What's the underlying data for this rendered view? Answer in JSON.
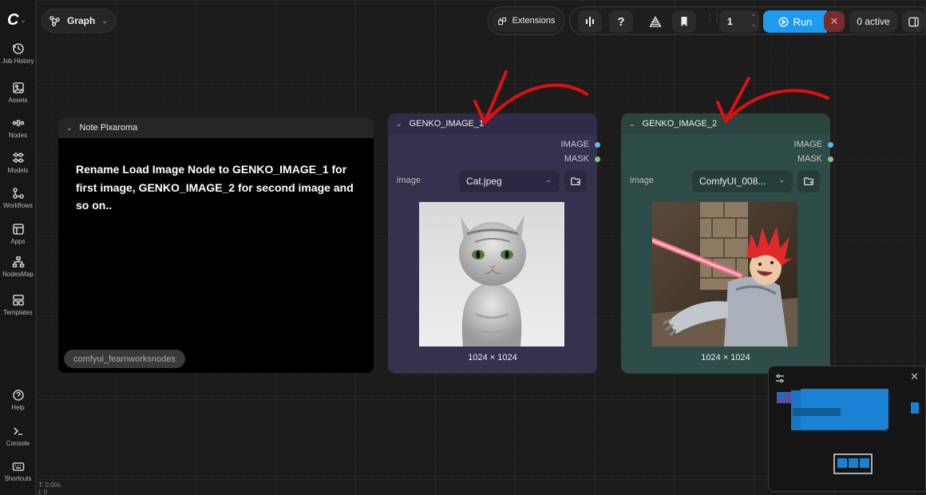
{
  "sidebar": {
    "logo_text": "C",
    "items": [
      {
        "icon": "history-icon",
        "label": "Job History"
      },
      {
        "icon": "image-icon",
        "label": "Assets"
      },
      {
        "icon": "nodes-icon",
        "label": "Nodes"
      },
      {
        "icon": "models-icon",
        "label": "Models"
      },
      {
        "icon": "workflow-icon",
        "label": "Workflows"
      },
      {
        "icon": "apps-icon",
        "label": "Apps"
      },
      {
        "icon": "sitemap-icon",
        "label": "NodesMap"
      },
      {
        "icon": "templates-icon",
        "label": "Templates"
      }
    ],
    "bottom_items": [
      {
        "icon": "help-icon",
        "label": "Help"
      },
      {
        "icon": "terminal-icon",
        "label": "Console"
      },
      {
        "icon": "keyboard-icon",
        "label": "Shortcuts"
      }
    ],
    "status_time": "T: 0.00s",
    "status_line2": "I: 0"
  },
  "topbar": {
    "graph_label": "Graph",
    "extensions_label": "Extensions",
    "queue_count": "1",
    "run_label": "Run",
    "active_label": "0 active",
    "stop_icon": "x",
    "help_label": "?"
  },
  "canvas": {
    "note_node": {
      "title": "Note Pixaroma",
      "text": "Rename Load Image Node to GENKO_IMAGE_1 for first image, GENKO_IMAGE_2 for second image and so on..",
      "tag": "comfyui_fearnworksnodes"
    },
    "image_nodes": [
      {
        "title": "GENKO_IMAGE_1",
        "outputs": [
          "IMAGE",
          "MASK"
        ],
        "widget_label": "image",
        "file": "Cat.jpeg",
        "dimensions": "1024 × 1024",
        "bg_color": "#353250",
        "header_color": "#2f2c48"
      },
      {
        "title": "GENKO_IMAGE_2",
        "outputs": [
          "IMAGE",
          "MASK"
        ],
        "widget_label": "image",
        "file": "ComfyUI_008...",
        "dimensions": "1024 × 1024",
        "bg_color": "#2e4c48",
        "header_color": "#2a4440"
      }
    ],
    "annotation_color": "#e01010"
  },
  "colors": {
    "accent": "#1d9bf0",
    "image_port": "#64b5f6",
    "mask_port": "#81c784"
  }
}
